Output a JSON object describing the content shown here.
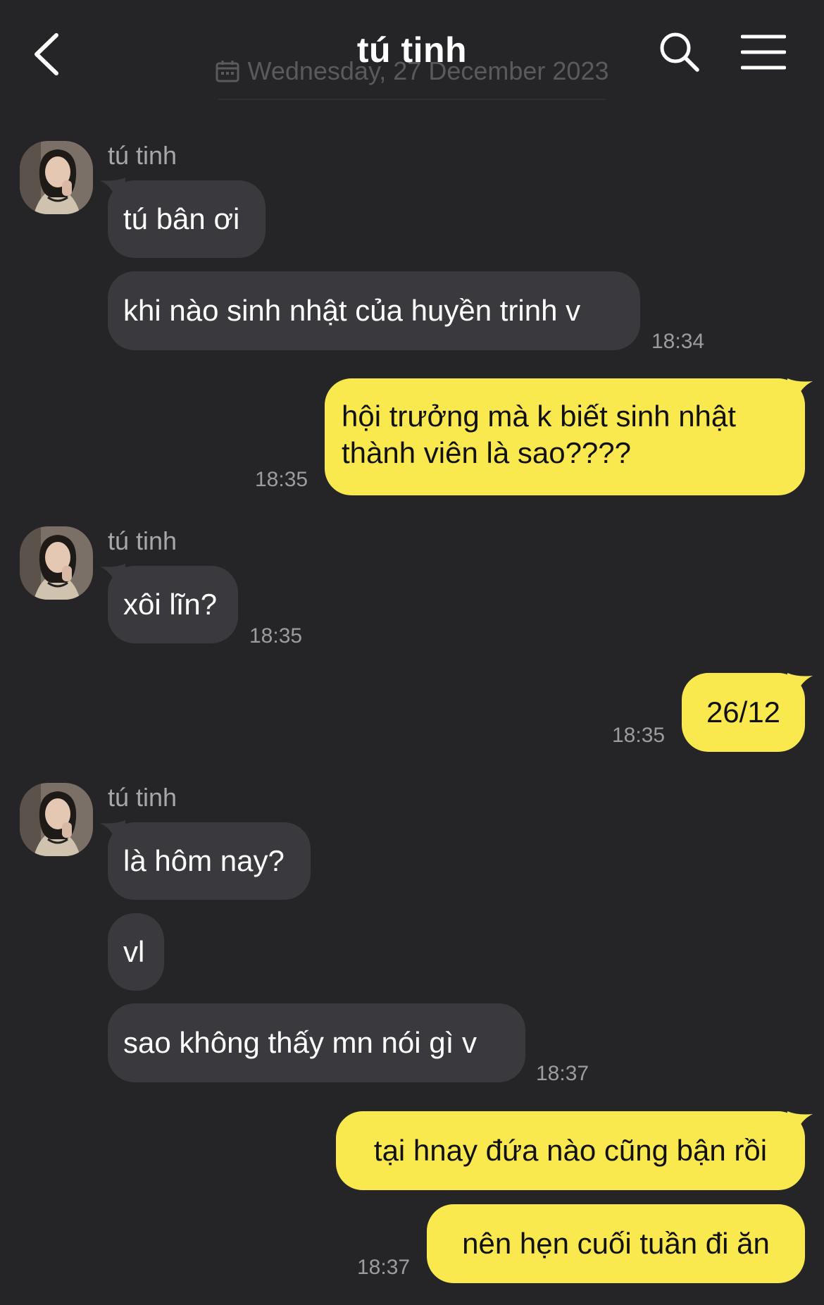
{
  "header": {
    "title": "tú tinh",
    "date_separator": "Wednesday, 27 December 2023",
    "back_icon": "chevron-left-icon",
    "search_icon": "search-icon",
    "menu_icon": "hamburger-menu-icon"
  },
  "colors": {
    "background": "#252528",
    "incoming_bubble": "#3a3a3e",
    "outgoing_bubble": "#fae84f",
    "timestamp": "#9c9ca0"
  },
  "messages": [
    {
      "id": "m1",
      "from": "tú tinh",
      "text": "tú bân ơi",
      "time": ""
    },
    {
      "id": "m2",
      "from": "tú tinh",
      "text": "khi nào sinh nhật của huyền trinh v",
      "time": "18:34"
    },
    {
      "id": "m3",
      "from": "me",
      "lines": [
        "hội trưởng mà k biết sinh nhật",
        "thành viên là sao????"
      ],
      "time": "18:35"
    },
    {
      "id": "m4",
      "from": "tú tinh",
      "text": "xôi lĩn?",
      "time": "18:35"
    },
    {
      "id": "m5",
      "from": "me",
      "text": "26/12",
      "time": "18:35"
    },
    {
      "id": "m6",
      "from": "tú tinh",
      "text": "là hôm nay?",
      "time": ""
    },
    {
      "id": "m7",
      "from": "tú tinh",
      "text": "vl",
      "time": ""
    },
    {
      "id": "m8",
      "from": "tú tinh",
      "text": "sao không thấy mn nói gì v",
      "time": "18:37"
    },
    {
      "id": "m9",
      "from": "me",
      "text": "tại hnay đứa nào cũng bận rồi",
      "time": ""
    },
    {
      "id": "m10",
      "from": "me",
      "text": "nên hẹn cuối tuần đi ăn",
      "time": "18:37"
    }
  ]
}
